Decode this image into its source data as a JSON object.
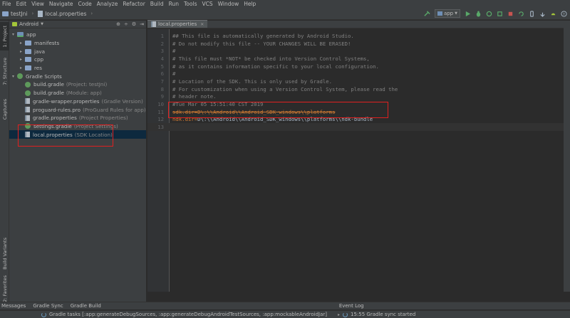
{
  "menu": [
    "File",
    "Edit",
    "View",
    "Navigate",
    "Code",
    "Analyze",
    "Refactor",
    "Build",
    "Run",
    "Tools",
    "VCS",
    "Window",
    "Help"
  ],
  "breadcrumb": {
    "project": "testJni",
    "file": "local.properties"
  },
  "toolbar": {
    "run_config": "app"
  },
  "left_tabs": {
    "project": "1: Project",
    "structure": "7: Structure",
    "captures": "Captures",
    "build_variants": "Build Variants",
    "favorites": "2: Favorites"
  },
  "project_panel": {
    "view_mode": "Android",
    "items": [
      {
        "label": "app",
        "secondary": "",
        "level": 0,
        "toggle": "▾",
        "icon": "module-icon"
      },
      {
        "label": "manifests",
        "secondary": "",
        "level": 1,
        "toggle": "▸",
        "icon": "folder-icon"
      },
      {
        "label": "java",
        "secondary": "",
        "level": 1,
        "toggle": "▸",
        "icon": "folder-icon"
      },
      {
        "label": "cpp",
        "secondary": "",
        "level": 1,
        "toggle": "▸",
        "icon": "folder-icon"
      },
      {
        "label": "res",
        "secondary": "",
        "level": 1,
        "toggle": "▸",
        "icon": "folder-icon"
      },
      {
        "label": "Gradle Scripts",
        "secondary": "",
        "level": 0,
        "toggle": "▾",
        "icon": "gradle-icon"
      },
      {
        "label": "build.gradle",
        "secondary": "(Project: testJni)",
        "level": 1,
        "toggle": "",
        "icon": "gradle-icon"
      },
      {
        "label": "build.gradle",
        "secondary": "(Module: app)",
        "level": 1,
        "toggle": "",
        "icon": "gradle-icon"
      },
      {
        "label": "gradle-wrapper.properties",
        "secondary": "(Gradle Version)",
        "level": 1,
        "toggle": "",
        "icon": "properties-icon"
      },
      {
        "label": "proguard-rules.pro",
        "secondary": "(ProGuard Rules for app)",
        "level": 1,
        "toggle": "",
        "icon": "properties-icon"
      },
      {
        "label": "gradle.properties",
        "secondary": "(Project Properties)",
        "level": 1,
        "toggle": "",
        "icon": "properties-icon"
      },
      {
        "label": "settings.gradle",
        "secondary": "(Project Settings)",
        "level": 1,
        "toggle": "",
        "icon": "gradle-icon"
      },
      {
        "label": "local.properties",
        "secondary": "(SDK Location)",
        "level": 1,
        "toggle": "",
        "icon": "properties-icon",
        "selected": true
      }
    ]
  },
  "editor": {
    "tab_label": "local.properties",
    "lines": [
      {
        "n": "1",
        "text": "## This file is automatically generated by Android Studio.",
        "kind": "comment"
      },
      {
        "n": "2",
        "text": "# Do not modify this file -- YOUR CHANGES WILL BE ERASED!",
        "kind": "comment"
      },
      {
        "n": "3",
        "text": "#",
        "kind": "comment"
      },
      {
        "n": "4",
        "text": "# This file must *NOT* be checked into Version Control Systems,",
        "kind": "comment"
      },
      {
        "n": "5",
        "text": "# as it contains information specific to your local configuration.",
        "kind": "comment"
      },
      {
        "n": "6",
        "text": "#",
        "kind": "comment"
      },
      {
        "n": "7",
        "text": "# Location of the SDK. This is only used by Gradle.",
        "kind": "comment"
      },
      {
        "n": "8",
        "text": "# For customization when using a Version Control System, please read the",
        "kind": "comment"
      },
      {
        "n": "9",
        "text": "# header note.",
        "kind": "comment"
      },
      {
        "n": "10",
        "text": "#Tue Mar 05 15:51:40 CST 2019",
        "kind": "comment"
      },
      {
        "n": "11",
        "key": "sdk.dir",
        "value": "D\\:\\\\Android\\\\Android_SDK_windows\\\\platforms",
        "kind": "prop"
      },
      {
        "n": "12",
        "key": "ndk.dir",
        "value": "D\\:\\\\Android\\\\Android_SDK_windows\\\\platforms\\\\ndk-bundle",
        "kind": "prop"
      },
      {
        "n": "13",
        "text": "",
        "kind": "empty"
      }
    ]
  },
  "bottom_tabs": {
    "messages": "Messages",
    "gradle_sync": "Gradle Sync",
    "gradle_build": "Gradle Build",
    "event_log": "Event Log"
  },
  "status": {
    "tasks": "Gradle tasks [:app:generateDebugSources, :app:generateDebugAndroidTestSources, :app:mockableAndroidJar]",
    "event": "15:55 Gradle sync started"
  },
  "colors": {
    "highlight": "#e02020",
    "comment": "#808080",
    "key": "#cc7832"
  }
}
